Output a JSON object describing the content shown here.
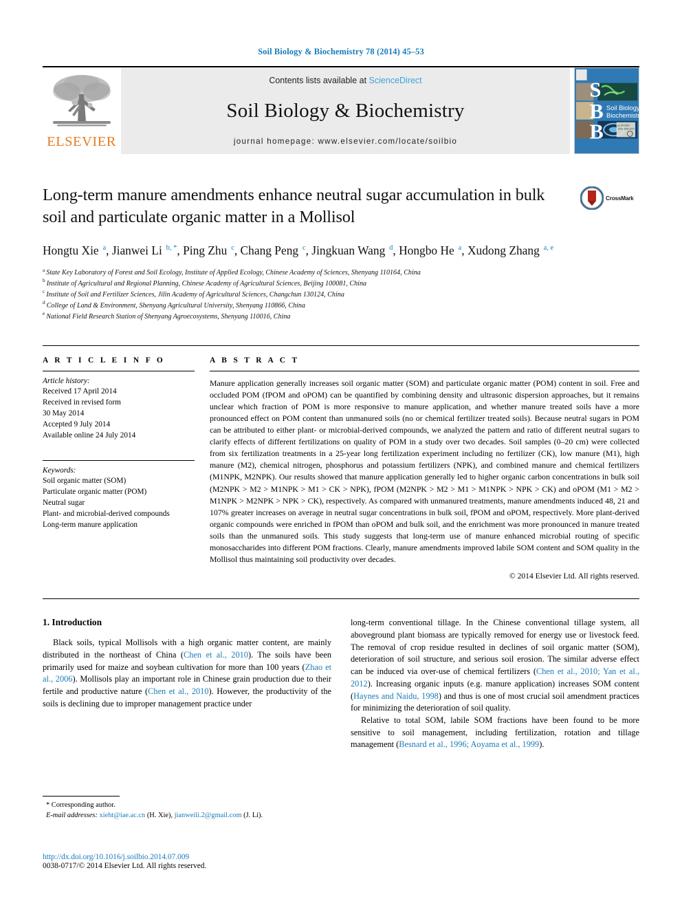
{
  "running_head": "Soil Biology & Biochemistry 78 (2014) 45–53",
  "masthead": {
    "contents_prefix": "Contents lists available at",
    "sciencedirect": "ScienceDirect",
    "journal_name": "Soil Biology & Biochemistry",
    "homepage": "journal homepage: www.elsevier.com/locate/soilbio",
    "publisher_wordmark": "ELSEVIER",
    "cover_letters": [
      "S",
      "B",
      "B"
    ],
    "cover_title_line1": "Soil Biology &",
    "cover_title_line2": "Biochemistry"
  },
  "article": {
    "title": "Long-term manure amendments enhance neutral sugar accumulation in bulk soil and particulate organic matter in a Mollisol",
    "crossmark_label": "CrossMark",
    "authors_html": "Hongtu Xie <sup>a</sup>, Jianwei Li <sup>b, *</sup>, Ping Zhu <sup>c</sup>, Chang Peng <sup>c</sup>, Jingkuan Wang <sup>d</sup>, Hongbo He <sup>a</sup>, Xudong Zhang <sup>a, e</sup>",
    "affiliations": [
      {
        "marker": "a",
        "text": "State Key Laboratory of Forest and Soil Ecology, Institute of Applied Ecology, Chinese Academy of Sciences, Shenyang 110164, China"
      },
      {
        "marker": "b",
        "text": "Institute of Agricultural and Regional Planning, Chinese Academy of Agricultural Sciences, Beijing 100081, China"
      },
      {
        "marker": "c",
        "text": "Institute of Soil and Fertilizer Sciences, Jilin Academy of Agricultural Sciences, Changchun 130124, China"
      },
      {
        "marker": "d",
        "text": "College of Land & Environment, Shenyang Agricultural University, Shenyang 110866, China"
      },
      {
        "marker": "e",
        "text": "National Field Research Station of Shenyang Agroecosystems, Shenyang 110016, China"
      }
    ]
  },
  "article_info": {
    "heading": "A R T I C L E  I N F O",
    "history_label": "Article history:",
    "history_lines": [
      "Received 17 April 2014",
      "Received in revised form",
      "30 May 2014",
      "Accepted 9 July 2014",
      "Available online 24 July 2014"
    ],
    "keywords_label": "Keywords:",
    "keywords": [
      "Soil organic matter (SOM)",
      "Particulate organic matter (POM)",
      "Neutral sugar",
      "Plant- and microbial-derived compounds",
      "Long-term manure application"
    ]
  },
  "abstract": {
    "heading": "A B S T R A C T",
    "text": "Manure application generally increases soil organic matter (SOM) and particulate organic matter (POM) content in soil. Free and occluded POM (fPOM and oPOM) can be quantified by combining density and ultrasonic dispersion approaches, but it remains unclear which fraction of POM is more responsive to manure application, and whether manure treated soils have a more pronounced effect on POM content than unmanured soils (no or chemical fertilizer treated soils). Because neutral sugars in POM can be attributed to either plant- or microbial-derived compounds, we analyzed the pattern and ratio of different neutral sugars to clarify effects of different fertilizations on quality of POM in a study over two decades. Soil samples (0–20 cm) were collected from six fertilization treatments in a 25-year long fertilization experiment including no fertilizer (CK), low manure (M1), high manure (M2), chemical nitrogen, phosphorus and potassium fertilizers (NPK), and combined manure and chemical fertilizers (M1NPK, M2NPK). Our results showed that manure application generally led to higher organic carbon concentrations in bulk soil (M2NPK > M2 > M1NPK > M1 > CK > NPK), fPOM (M2NPK > M2 > M1 > M1NPK > NPK > CK) and oPOM (M1 > M2 > M1NPK > M2NPK > NPK > CK), respectively. As compared with unmanured treatments, manure amendments induced 48, 21 and 107% greater increases on average in neutral sugar concentrations in bulk soil, fPOM and oPOM, respectively. More plant-derived organic compounds were enriched in fPOM than oPOM and bulk soil, and the enrichment was more pronounced in manure treated soils than the unmanured soils. This study suggests that long-term use of manure enhanced microbial routing of specific monosaccharides into different POM fractions. Clearly, manure amendments improved labile SOM content and SOM quality in the Mollisol thus maintaining soil productivity over decades.",
    "copyright": "© 2014 Elsevier Ltd. All rights reserved."
  },
  "introduction": {
    "section_number_title": "1. Introduction",
    "left_paragraph_html": "Black soils, typical Mollisols with a high organic matter content, are mainly distributed in the northeast of China (<span class=\"cite\">Chen et al., 2010</span>). The soils have been primarily used for maize and soybean cultivation for more than 100 years (<span class=\"cite\">Zhao et al., 2006</span>). Mollisols play an important role in Chinese grain production due to their fertile and productive nature (<span class=\"cite\">Chen et al., 2010</span>). However, the productivity of the soils is declining due to improper management practice under",
    "right_paragraph1_html": "long-term conventional tillage. In the Chinese conventional tillage system, all aboveground plant biomass are typically removed for energy use or livestock feed. The removal of crop residue resulted in declines of soil organic matter (SOM), deterioration of soil structure, and serious soil erosion. The similar adverse effect can be induced via over-use of chemical fertilizers (<span class=\"cite\">Chen et al., 2010; Yan et al., 2012</span>). Increasing organic inputs (e.g. manure application) increases SOM content (<span class=\"cite\">Haynes and Naidu, 1998</span>) and thus is one of most crucial soil amendment practices for minimizing the deterioration of soil quality.",
    "right_paragraph2_html": "Relative to total SOM, labile SOM fractions have been found to be more sensitive to soil management, including fertilization, rotation and tillage management (<span class=\"cite\">Besnard et al., 1996; Aoyama et al., 1999</span>)."
  },
  "footnotes": {
    "corresponding_author": "* Corresponding author.",
    "email_label": "E-mail addresses:",
    "email_html": "<span class=\"em-label\">E-mail addresses:</span> <span class=\"cite\">xieht@iae.ac.cn</span> (H. Xie), <span class=\"cite\">jianweili.2@gmail.com</span> (J. Li)."
  },
  "footer": {
    "doi": "http://dx.doi.org/10.1016/j.soilbio.2014.07.009",
    "issn_line": "0038-0717/© 2014 Elsevier Ltd. All rights reserved."
  },
  "colors": {
    "link_blue": "#1a7bb9",
    "sciencedirect_blue": "#3aa3d8",
    "elsevier_orange": "#e87b1e",
    "band_gray": "#ebebeb",
    "cover_blue": "#2f7ab5"
  }
}
